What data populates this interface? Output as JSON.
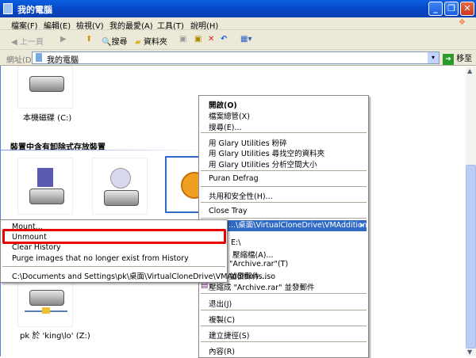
{
  "window": {
    "title": "我的電腦"
  },
  "menubar": [
    "檔案(F)",
    "編輯(E)",
    "檢視(V)",
    "我的最愛(A)",
    "工具(T)",
    "說明(H)"
  ],
  "toolbar": {
    "back": "上一頁",
    "search": "搜尋",
    "folders": "資料夾"
  },
  "address": {
    "label": "網址(D)",
    "value": "我的電腦",
    "go": "移至"
  },
  "content": {
    "local_disk": "本機磁碟 (C:)",
    "section_removable": "裝置中含有卸除式存放裝置",
    "network_drive": "pk 於 'king\\lo' (Z:)"
  },
  "context_menu": {
    "items_top": [
      "開啟(O)",
      "檔案總管(X)",
      "搜尋(E)..."
    ],
    "glary": [
      "用 Glary Utilities 粉碎",
      "用 Glary Utilities 尋找空的資料夾",
      "用 Glary Utilities 分析空間大小"
    ],
    "puran": "Puran Defrag",
    "share": "共用和安全性(H)...",
    "close_tray": "Close Tray",
    "vcd_item": "...\\桌面\\VirtualCloneDrive\\VMAdditions.iso)",
    "partial": [
      "E:\\",
      "壓縮檔(A)...",
      "\"Archive.rar\"(T)",
      "並發郵件..."
    ],
    "rar_email": "壓縮成 \"Archive.rar\" 並發郵件",
    "eject": "退出(J)",
    "copy": "複製(C)",
    "shortcut": "建立捷徑(S)",
    "properties": "內容(R)"
  },
  "submenu": {
    "mount": "Mount...",
    "unmount": "Unmount",
    "clear": "Clear History",
    "purge": "Purge images that no longer exist from History",
    "recent": "C:\\Documents and Settings\\pk\\桌面\\VirtualCloneDrive\\VMAdditions.iso"
  }
}
